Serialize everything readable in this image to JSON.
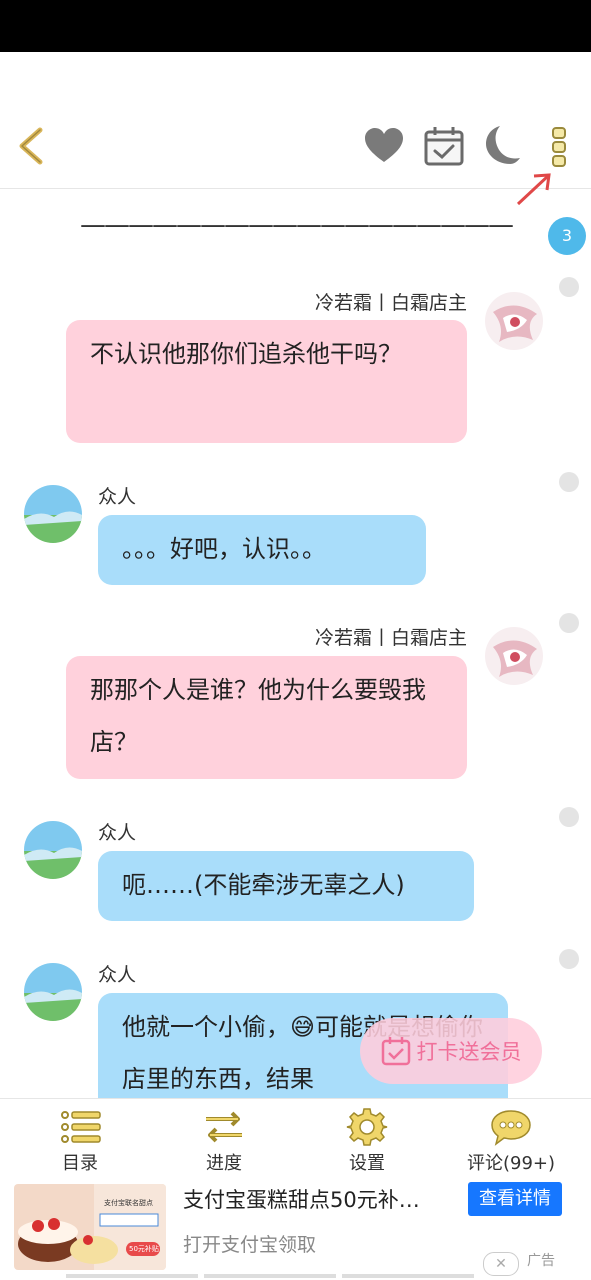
{
  "header": {
    "icons": [
      "back-chevron-icon",
      "heart-icon",
      "calendar-check-icon",
      "moon-icon",
      "more-vertical-icon"
    ],
    "accent_color": "#d9b65a",
    "arrow_color": "#e04848"
  },
  "chapter": {
    "divider": "——————————————————",
    "badge_count": "3"
  },
  "messages": [
    {
      "speaker": "冷若霜丨白霜店主",
      "text": "不认识他那你们追杀他干吗？",
      "side": "right",
      "color": "#ffd1dc"
    },
    {
      "speaker": "众人",
      "text": "。。。好吧，认识。。",
      "side": "left",
      "color": "#a9ddfa"
    },
    {
      "speaker": "冷若霜丨白霜店主",
      "text": "那那个人是谁？他为什么要毁我店？",
      "side": "right",
      "color": "#ffd1dc"
    },
    {
      "speaker": "众人",
      "text": "呃……(不能牵涉无辜之人)",
      "side": "left",
      "color": "#a9ddfa"
    },
    {
      "speaker": "众人",
      "text": "他就一个小偷，😅可能就是想偷你店里的东西，结果",
      "side": "left",
      "color": "#a9ddfa"
    }
  ],
  "promo": {
    "label": "打卡送会员"
  },
  "bottom_nav": [
    {
      "label": "目录",
      "icon": "list-icon"
    },
    {
      "label": "进度",
      "icon": "swap-arrows-icon"
    },
    {
      "label": "设置",
      "icon": "gear-icon"
    },
    {
      "label": "评论(99+)",
      "icon": "comment-icon"
    }
  ],
  "ad": {
    "title": "支付宝蛋糕甜点50元补…",
    "subtitle": "打开支付宝领取",
    "button": "查看详情",
    "label": "广告",
    "close": "✕",
    "image_caption": "支付宝联名甜点",
    "image_tag": "50元补贴"
  }
}
